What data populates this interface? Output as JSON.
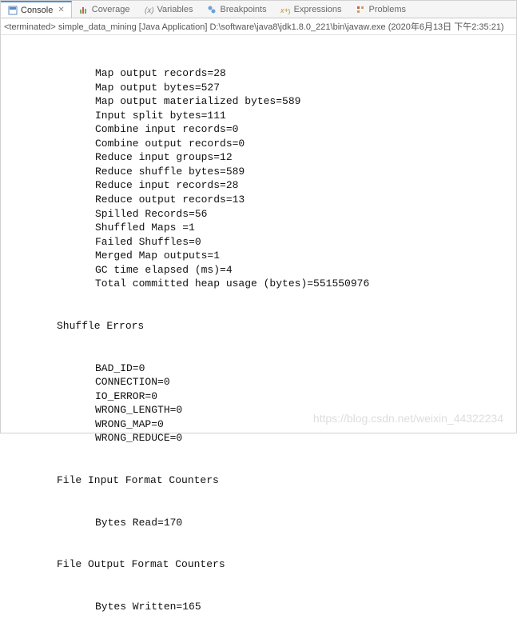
{
  "tabs": {
    "console": {
      "label": "Console"
    },
    "coverage": {
      "label": "Coverage"
    },
    "variables": {
      "label": "Variables"
    },
    "breakpoints": {
      "label": "Breakpoints"
    },
    "expressions": {
      "label": "Expressions"
    },
    "problems": {
      "label": "Problems"
    }
  },
  "status": {
    "prefix": "<terminated>",
    "app": "simple_data_mining",
    "type": "[Java Application]",
    "path": "D:\\software\\java8\\jdk1.8.0_221\\bin\\javaw.exe",
    "timestamp": "(2020年6月13日 下午2:35:21)"
  },
  "output": {
    "metrics": [
      "Map output records=28",
      "Map output bytes=527",
      "Map output materialized bytes=589",
      "Input split bytes=111",
      "Combine input records=0",
      "Combine output records=0",
      "Reduce input groups=12",
      "Reduce shuffle bytes=589",
      "Reduce input records=28",
      "Reduce output records=13",
      "Spilled Records=56",
      "Shuffled Maps =1",
      "Failed Shuffles=0",
      "Merged Map outputs=1",
      "GC time elapsed (ms)=4",
      "Total committed heap usage (bytes)=551550976"
    ],
    "shuffle_header": "Shuffle Errors",
    "shuffle_items": [
      "BAD_ID=0",
      "CONNECTION=0",
      "IO_ERROR=0",
      "WRONG_LENGTH=0",
      "WRONG_MAP=0",
      "WRONG_REDUCE=0"
    ],
    "file_input_header": "File Input Format Counters",
    "file_input_items": [
      "Bytes Read=170"
    ],
    "file_output_header": "File Output Format Counters",
    "file_output_items": [
      "Bytes Written=165"
    ]
  },
  "watermark": "https://blog.csdn.net/weixin_44322234"
}
